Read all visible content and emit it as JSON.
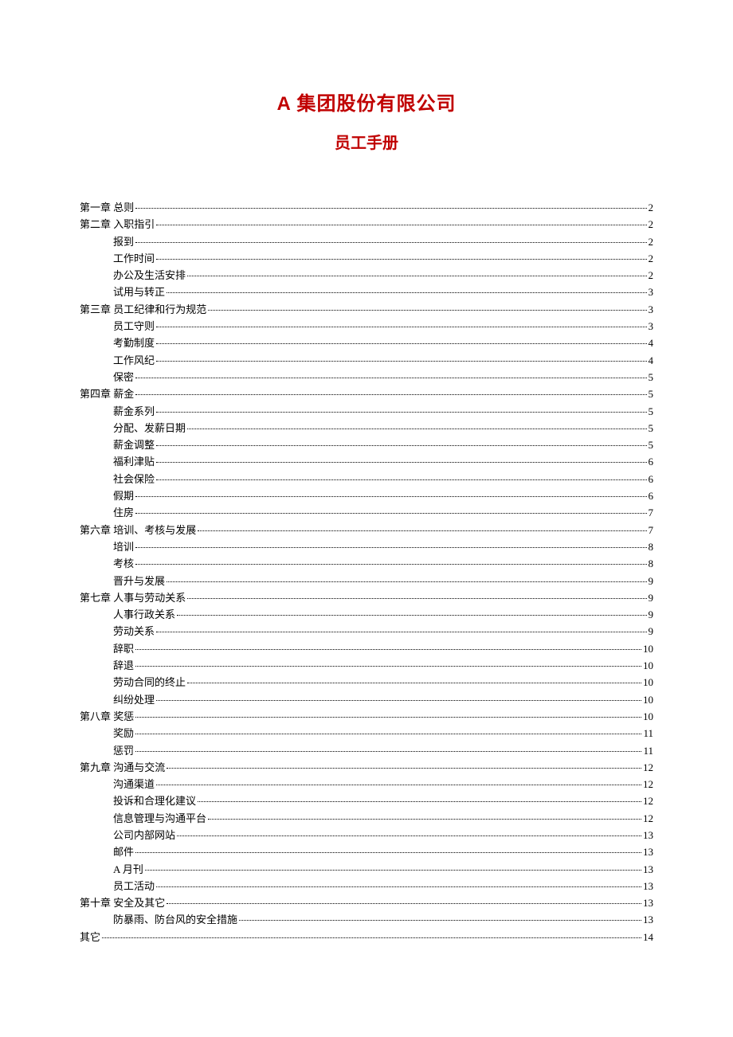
{
  "header": {
    "title_main": "A 集团股份有限公司",
    "title_sub": "员工手册"
  },
  "toc": [
    {
      "label": "第一章  总则",
      "page": "2",
      "level": 1
    },
    {
      "label": "第二章  入职指引",
      "page": "2",
      "level": 1
    },
    {
      "label": "报到",
      "page": "2",
      "level": 2
    },
    {
      "label": "工作时间",
      "page": "2",
      "level": 2
    },
    {
      "label": "办公及生活安排",
      "page": "2",
      "level": 2
    },
    {
      "label": "试用与转正",
      "page": "3",
      "level": 2
    },
    {
      "label": "第三章  员工纪律和行为规范",
      "page": "3",
      "level": 1
    },
    {
      "label": "员工守则",
      "page": "3",
      "level": 2
    },
    {
      "label": "考勤制度",
      "page": "4",
      "level": 2
    },
    {
      "label": "工作风纪",
      "page": "4",
      "level": 2
    },
    {
      "label": "保密",
      "page": "5",
      "level": 2
    },
    {
      "label": "第四章  薪金",
      "page": "5",
      "level": 1
    },
    {
      "label": "薪金系列",
      "page": "5",
      "level": 2
    },
    {
      "label": "分配、发薪日期",
      "page": "5",
      "level": 2
    },
    {
      "label": "薪金调整",
      "page": "5",
      "level": 2
    },
    {
      "label": "福利津贴",
      "page": "6",
      "level": 2
    },
    {
      "label": "社会保险",
      "page": "6",
      "level": 2
    },
    {
      "label": "假期",
      "page": "6",
      "level": 2
    },
    {
      "label": "住房",
      "page": "7",
      "level": 2
    },
    {
      "label": "第六章  培训、考核与发展",
      "page": "7",
      "level": 1
    },
    {
      "label": "培训",
      "page": "8",
      "level": 2
    },
    {
      "label": "考核",
      "page": "8",
      "level": 2
    },
    {
      "label": "晋升与发展",
      "page": "9",
      "level": 2
    },
    {
      "label": "第七章  人事与劳动关系",
      "page": "9",
      "level": 1
    },
    {
      "label": "人事行政关系",
      "page": "9",
      "level": 2
    },
    {
      "label": "劳动关系",
      "page": "9",
      "level": 2
    },
    {
      "label": "辞职",
      "page": "10",
      "level": 2
    },
    {
      "label": "辞退",
      "page": "10",
      "level": 2
    },
    {
      "label": "劳动合同的终止",
      "page": "10",
      "level": 2
    },
    {
      "label": "纠纷处理",
      "page": "10",
      "level": 2
    },
    {
      "label": "第八章  奖惩",
      "page": "10",
      "level": 1
    },
    {
      "label": "奖励",
      "page": "11",
      "level": 2
    },
    {
      "label": "惩罚",
      "page": "11",
      "level": 2
    },
    {
      "label": "第九章  沟通与交流",
      "page": "12",
      "level": 1
    },
    {
      "label": "沟通渠道",
      "page": "12",
      "level": 2
    },
    {
      "label": "投诉和合理化建议",
      "page": "12",
      "level": 2
    },
    {
      "label": "信息管理与沟通平台",
      "page": "12",
      "level": 2
    },
    {
      "label": "公司内部网站",
      "page": "13",
      "level": 2
    },
    {
      "label": "邮件",
      "page": "13",
      "level": 2
    },
    {
      "label": "A 月刊",
      "page": "13",
      "level": 2
    },
    {
      "label": "员工活动",
      "page": "13",
      "level": 2
    },
    {
      "label": "第十章  安全及其它",
      "page": "13",
      "level": 1
    },
    {
      "label": "防暴雨、防台风的安全措施",
      "page": "13",
      "level": 2
    },
    {
      "label": "其它",
      "page": "14",
      "level": 0
    }
  ]
}
